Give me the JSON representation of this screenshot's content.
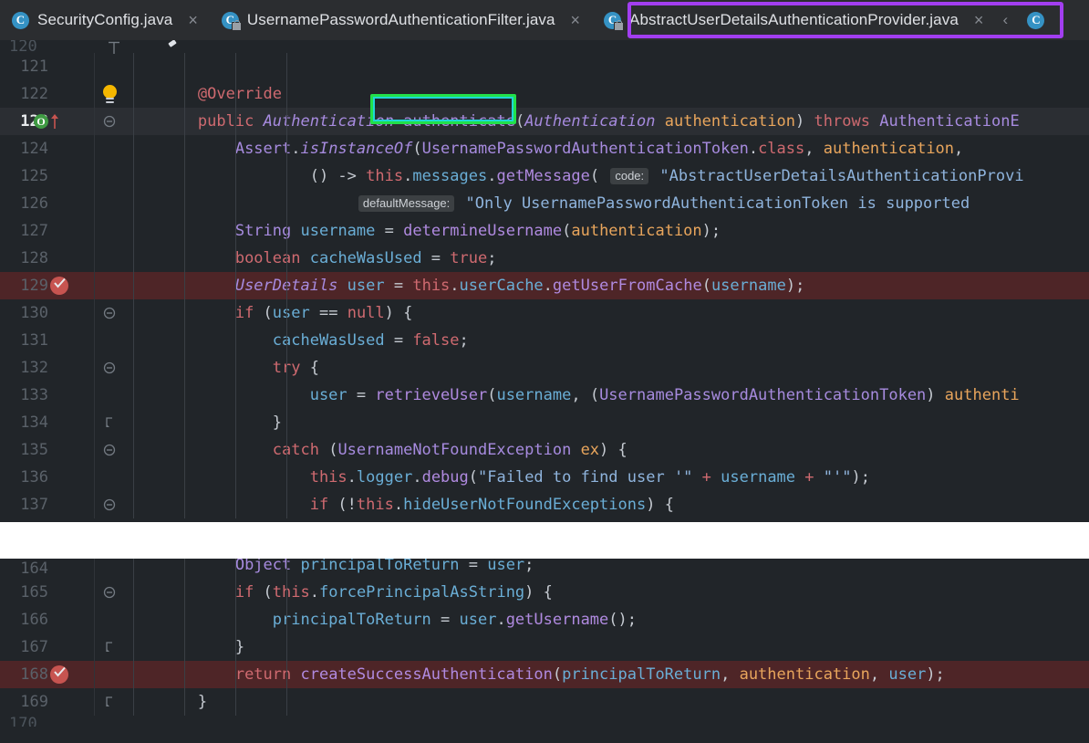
{
  "app": "IntelliJ IDEA Java Editor",
  "tabs": [
    {
      "label": "SecurityConfig.java",
      "icon": "java-class-icon",
      "active": false,
      "locked": false,
      "close_label": "×"
    },
    {
      "label": "UsernamePasswordAuthenticationFilter.java",
      "icon": "java-class-icon",
      "active": false,
      "locked": true,
      "close_label": "×"
    },
    {
      "label": "AbstractUserDetailsAuthenticationProvider.java",
      "icon": "java-class-icon",
      "active": true,
      "locked": true,
      "close_label": "×"
    }
  ],
  "tab_scroll_left_label": "‹",
  "annotations": {
    "active_tab_box_color": "#a23ef0",
    "method_box_color": "#22e04a",
    "method_box_inner_color": "#1fd6d6",
    "highlighted_method_name": "authenticate"
  },
  "gutter_icons": {
    "lightbulb": "lightbulb-icon",
    "override_marker": "O",
    "implemented_arrow": "up-arrow-icon",
    "breakpoint": "breakpoint-verified-icon",
    "fold_collapse": "fold-arrow-icon"
  },
  "editor": {
    "file": "AbstractUserDetailsAuthenticationProvider.java",
    "top_section": {
      "first_partial_line": "120",
      "lines": [
        {
          "number": "121",
          "indent": 0,
          "current": false,
          "breakpoint": false,
          "tokens": []
        },
        {
          "number": "122",
          "indent": 0,
          "current": false,
          "breakpoint": false,
          "bulb": true,
          "tokens": [
            {
              "t": "        ",
              "c": "pl"
            },
            {
              "t": "@Override",
              "c": "kw"
            }
          ]
        },
        {
          "number": "123",
          "indent": 0,
          "current": true,
          "breakpoint": false,
          "override": true,
          "fold": "collapse",
          "tokens": [
            {
              "t": "        ",
              "c": "pl"
            },
            {
              "t": "public",
              "c": "kw"
            },
            {
              "t": " ",
              "c": "pl"
            },
            {
              "t": "Authentication",
              "c": "typ"
            },
            {
              "t": " ",
              "c": "pl"
            },
            {
              "t": "authenticate",
              "c": "typn"
            },
            {
              "t": "(",
              "c": "pl"
            },
            {
              "t": "Authentication",
              "c": "typ"
            },
            {
              "t": " ",
              "c": "pl"
            },
            {
              "t": "authentication",
              "c": "par"
            },
            {
              "t": ")",
              "c": "pl"
            },
            {
              "t": " ",
              "c": "pl"
            },
            {
              "t": "throws",
              "c": "kw"
            },
            {
              "t": " ",
              "c": "pl"
            },
            {
              "t": "AuthenticationE",
              "c": "typn"
            }
          ]
        },
        {
          "number": "124",
          "indent": 0,
          "current": false,
          "breakpoint": false,
          "tokens": [
            {
              "t": "            ",
              "c": "pl"
            },
            {
              "t": "Assert",
              "c": "typn"
            },
            {
              "t": ".",
              "c": "pl"
            },
            {
              "t": "isInstanceOf",
              "c": "mthi"
            },
            {
              "t": "(",
              "c": "pl"
            },
            {
              "t": "UsernamePasswordAuthenticationToken",
              "c": "typn"
            },
            {
              "t": ".",
              "c": "pl"
            },
            {
              "t": "class",
              "c": "kw"
            },
            {
              "t": ", ",
              "c": "pl"
            },
            {
              "t": "authentication",
              "c": "par"
            },
            {
              "t": ",",
              "c": "pl"
            }
          ]
        },
        {
          "number": "125",
          "indent": 0,
          "current": false,
          "breakpoint": false,
          "tokens": [
            {
              "t": "                    ",
              "c": "pl"
            },
            {
              "t": "()",
              "c": "pl"
            },
            {
              "t": " -> ",
              "c": "pl"
            },
            {
              "t": "this",
              "c": "ths"
            },
            {
              "t": ".",
              "c": "pl"
            },
            {
              "t": "messages",
              "c": "var"
            },
            {
              "t": ".",
              "c": "pl"
            },
            {
              "t": "getMessage",
              "c": "mth"
            },
            {
              "t": "(",
              "c": "pl"
            },
            {
              "t": " ",
              "c": "pl"
            },
            {
              "t": "code:",
              "c": "hint"
            },
            {
              "t": " ",
              "c": "pl"
            },
            {
              "t": "\"AbstractUserDetailsAuthenticationProvi",
              "c": "str"
            }
          ]
        },
        {
          "number": "126",
          "indent": 0,
          "current": false,
          "breakpoint": false,
          "tokens": [
            {
              "t": "                         ",
              "c": "pl"
            },
            {
              "t": "defaultMessage:",
              "c": "hint"
            },
            {
              "t": " ",
              "c": "pl"
            },
            {
              "t": "\"Only UsernamePasswordAuthenticationToken is supported",
              "c": "str"
            }
          ]
        },
        {
          "number": "127",
          "indent": 0,
          "current": false,
          "breakpoint": false,
          "tokens": [
            {
              "t": "            ",
              "c": "pl"
            },
            {
              "t": "String",
              "c": "typn"
            },
            {
              "t": " ",
              "c": "pl"
            },
            {
              "t": "username",
              "c": "var"
            },
            {
              "t": " = ",
              "c": "pl"
            },
            {
              "t": "determineUsername",
              "c": "mth"
            },
            {
              "t": "(",
              "c": "pl"
            },
            {
              "t": "authentication",
              "c": "par"
            },
            {
              "t": ");",
              "c": "pl"
            }
          ]
        },
        {
          "number": "128",
          "indent": 0,
          "current": false,
          "breakpoint": false,
          "tokens": [
            {
              "t": "            ",
              "c": "pl"
            },
            {
              "t": "boolean",
              "c": "kw"
            },
            {
              "t": " ",
              "c": "pl"
            },
            {
              "t": "cacheWasUsed",
              "c": "var"
            },
            {
              "t": " = ",
              "c": "pl"
            },
            {
              "t": "true",
              "c": "kw"
            },
            {
              "t": ";",
              "c": "pl"
            }
          ]
        },
        {
          "number": "129",
          "indent": 0,
          "current": false,
          "breakpoint": true,
          "bp_icon": true,
          "tokens": [
            {
              "t": "            ",
              "c": "pl"
            },
            {
              "t": "UserDetails",
              "c": "typ"
            },
            {
              "t": " ",
              "c": "pl"
            },
            {
              "t": "user",
              "c": "var"
            },
            {
              "t": " = ",
              "c": "pl"
            },
            {
              "t": "this",
              "c": "ths"
            },
            {
              "t": ".",
              "c": "pl"
            },
            {
              "t": "userCache",
              "c": "var"
            },
            {
              "t": ".",
              "c": "pl"
            },
            {
              "t": "getUserFromCache",
              "c": "mth"
            },
            {
              "t": "(",
              "c": "pl"
            },
            {
              "t": "username",
              "c": "var"
            },
            {
              "t": ");",
              "c": "pl"
            }
          ]
        },
        {
          "number": "130",
          "indent": 0,
          "current": false,
          "breakpoint": false,
          "fold": "collapse",
          "tokens": [
            {
              "t": "            ",
              "c": "pl"
            },
            {
              "t": "if",
              "c": "kw"
            },
            {
              "t": " (",
              "c": "pl"
            },
            {
              "t": "user",
              "c": "var"
            },
            {
              "t": " == ",
              "c": "pl"
            },
            {
              "t": "null",
              "c": "kw"
            },
            {
              "t": ") {",
              "c": "pl"
            }
          ]
        },
        {
          "number": "131",
          "indent": 0,
          "current": false,
          "breakpoint": false,
          "tokens": [
            {
              "t": "                ",
              "c": "pl"
            },
            {
              "t": "cacheWasUsed",
              "c": "var"
            },
            {
              "t": " = ",
              "c": "pl"
            },
            {
              "t": "false",
              "c": "kw"
            },
            {
              "t": ";",
              "c": "pl"
            }
          ]
        },
        {
          "number": "132",
          "indent": 0,
          "current": false,
          "breakpoint": false,
          "fold": "collapse",
          "tokens": [
            {
              "t": "                ",
              "c": "pl"
            },
            {
              "t": "try",
              "c": "kw"
            },
            {
              "t": " {",
              "c": "pl"
            }
          ]
        },
        {
          "number": "133",
          "indent": 0,
          "current": false,
          "breakpoint": false,
          "tokens": [
            {
              "t": "                    ",
              "c": "pl"
            },
            {
              "t": "user",
              "c": "var"
            },
            {
              "t": " = ",
              "c": "pl"
            },
            {
              "t": "retrieveUser",
              "c": "mth"
            },
            {
              "t": "(",
              "c": "pl"
            },
            {
              "t": "username",
              "c": "var"
            },
            {
              "t": ", (",
              "c": "pl"
            },
            {
              "t": "UsernamePasswordAuthenticationToken",
              "c": "typn"
            },
            {
              "t": ") ",
              "c": "pl"
            },
            {
              "t": "authenti",
              "c": "par"
            }
          ]
        },
        {
          "number": "134",
          "indent": 0,
          "current": false,
          "breakpoint": false,
          "fold": "end",
          "tokens": [
            {
              "t": "                ",
              "c": "pl"
            },
            {
              "t": "}",
              "c": "pl"
            }
          ]
        },
        {
          "number": "135",
          "indent": 0,
          "current": false,
          "breakpoint": false,
          "fold": "collapse",
          "tokens": [
            {
              "t": "                ",
              "c": "pl"
            },
            {
              "t": "catch",
              "c": "kw"
            },
            {
              "t": " (",
              "c": "pl"
            },
            {
              "t": "UsernameNotFoundException",
              "c": "typn"
            },
            {
              "t": " ",
              "c": "pl"
            },
            {
              "t": "ex",
              "c": "par"
            },
            {
              "t": ") {",
              "c": "pl"
            }
          ]
        },
        {
          "number": "136",
          "indent": 0,
          "current": false,
          "breakpoint": false,
          "tokens": [
            {
              "t": "                    ",
              "c": "pl"
            },
            {
              "t": "this",
              "c": "ths"
            },
            {
              "t": ".",
              "c": "pl"
            },
            {
              "t": "logger",
              "c": "var"
            },
            {
              "t": ".",
              "c": "pl"
            },
            {
              "t": "debug",
              "c": "mth"
            },
            {
              "t": "(",
              "c": "pl"
            },
            {
              "t": "\"Failed to find user '\"",
              "c": "str"
            },
            {
              "t": " + ",
              "c": "kw"
            },
            {
              "t": "username",
              "c": "var"
            },
            {
              "t": " + ",
              "c": "kw"
            },
            {
              "t": "\"'\"",
              "c": "str"
            },
            {
              "t": ");",
              "c": "pl"
            }
          ]
        },
        {
          "number": "137",
          "indent": 0,
          "current": false,
          "breakpoint": false,
          "fold": "collapse",
          "tokens": [
            {
              "t": "                    ",
              "c": "pl"
            },
            {
              "t": "if",
              "c": "kw"
            },
            {
              "t": " (!",
              "c": "pl"
            },
            {
              "t": "this",
              "c": "ths"
            },
            {
              "t": ".",
              "c": "pl"
            },
            {
              "t": "hideUserNotFoundExceptions",
              "c": "var"
            },
            {
              "t": ") {",
              "c": "pl"
            }
          ]
        }
      ]
    },
    "bottom_section": {
      "last_partial_line": "170",
      "lines": [
        {
          "number": "164",
          "indent": 0,
          "current": false,
          "breakpoint": false,
          "clipped_top": true,
          "tokens": [
            {
              "t": "            ",
              "c": "pl"
            },
            {
              "t": "Object",
              "c": "typn"
            },
            {
              "t": " ",
              "c": "pl"
            },
            {
              "t": "principalToReturn",
              "c": "var"
            },
            {
              "t": " = ",
              "c": "pl"
            },
            {
              "t": "user",
              "c": "var"
            },
            {
              "t": ";",
              "c": "pl"
            }
          ]
        },
        {
          "number": "165",
          "indent": 0,
          "current": false,
          "breakpoint": false,
          "fold": "collapse",
          "tokens": [
            {
              "t": "            ",
              "c": "pl"
            },
            {
              "t": "if",
              "c": "kw"
            },
            {
              "t": " (",
              "c": "pl"
            },
            {
              "t": "this",
              "c": "ths"
            },
            {
              "t": ".",
              "c": "pl"
            },
            {
              "t": "forcePrincipalAsString",
              "c": "var"
            },
            {
              "t": ") {",
              "c": "pl"
            }
          ]
        },
        {
          "number": "166",
          "indent": 0,
          "current": false,
          "breakpoint": false,
          "tokens": [
            {
              "t": "                ",
              "c": "pl"
            },
            {
              "t": "principalToReturn",
              "c": "var"
            },
            {
              "t": " = ",
              "c": "pl"
            },
            {
              "t": "user",
              "c": "var"
            },
            {
              "t": ".",
              "c": "pl"
            },
            {
              "t": "getUsername",
              "c": "mth"
            },
            {
              "t": "();",
              "c": "pl"
            }
          ]
        },
        {
          "number": "167",
          "indent": 0,
          "current": false,
          "breakpoint": false,
          "fold": "end",
          "tokens": [
            {
              "t": "            ",
              "c": "pl"
            },
            {
              "t": "}",
              "c": "pl"
            }
          ]
        },
        {
          "number": "168",
          "indent": 0,
          "current": false,
          "breakpoint": true,
          "bp_icon": true,
          "tokens": [
            {
              "t": "            ",
              "c": "pl"
            },
            {
              "t": "return",
              "c": "kw"
            },
            {
              "t": " ",
              "c": "pl"
            },
            {
              "t": "createSuccessAuthentication",
              "c": "mth"
            },
            {
              "t": "(",
              "c": "pl"
            },
            {
              "t": "principalToReturn",
              "c": "var"
            },
            {
              "t": ", ",
              "c": "pl"
            },
            {
              "t": "authentication",
              "c": "par"
            },
            {
              "t": ", ",
              "c": "pl"
            },
            {
              "t": "user",
              "c": "var"
            },
            {
              "t": ");",
              "c": "pl"
            }
          ]
        },
        {
          "number": "169",
          "indent": 0,
          "current": false,
          "breakpoint": false,
          "fold": "end",
          "tokens": [
            {
              "t": "        ",
              "c": "pl"
            },
            {
              "t": "}",
              "c": "pl"
            }
          ]
        }
      ]
    }
  },
  "colors": {
    "editor_background": "#212529",
    "tabbar_background": "#2b2d30",
    "current_line": "#2b2e33",
    "breakpoint_line": "#4e2527",
    "line_number": "#5a6169",
    "keyword": "#cf6a70",
    "type": "#a78bdf",
    "method": "#b08ae0",
    "variable": "#6aaed6",
    "parameter": "#e8a55c",
    "string": "#8fb4dd",
    "punctuation": "#c5cad1"
  }
}
